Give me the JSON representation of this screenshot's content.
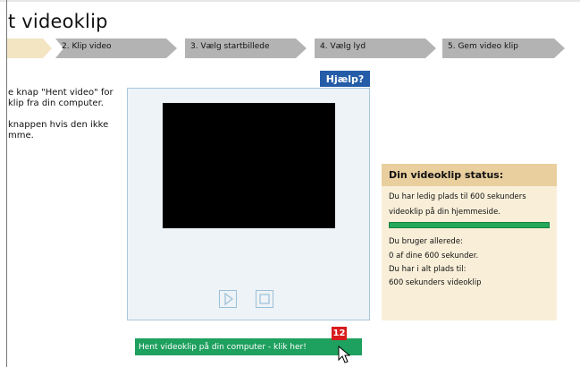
{
  "page": {
    "title": "t videoklip"
  },
  "steps": [
    {
      "label": ""
    },
    {
      "label": "2. Klip video"
    },
    {
      "label": "3. Vælg startbillede"
    },
    {
      "label": "4. Vælg lyd"
    },
    {
      "label": "5. Gem video klip"
    }
  ],
  "instructions": [
    "e knap \"Hent video\" for",
    "klip fra din computer.",
    "knappen hvis den ikke",
    "mme."
  ],
  "help": {
    "label": "Hjælp?"
  },
  "player": {
    "play_icon": "play-icon",
    "stop_icon": "stop-icon"
  },
  "status": {
    "header": "Din videoklip status:",
    "line1": "Du har ledig plads til 600 sekunders",
    "line2": "videoklip på din hjemmeside.",
    "progress_fraction": 1.0,
    "used_label": "Du bruger allerede:",
    "used_value": "0 af dine 600 sekunder.",
    "total_label": "Du har i alt plads til:",
    "total_value": "600 sekunders videoklip"
  },
  "upload": {
    "label": "Hent videoklip på din computer - klik her!",
    "badge": "12"
  },
  "colors": {
    "step_active": "#f3e4c2",
    "step_inactive": "#b3b3b3",
    "help_bg": "#245ca8",
    "status_header": "#e9cf9e",
    "progress": "#24a85a",
    "badge": "#d81c1c"
  }
}
